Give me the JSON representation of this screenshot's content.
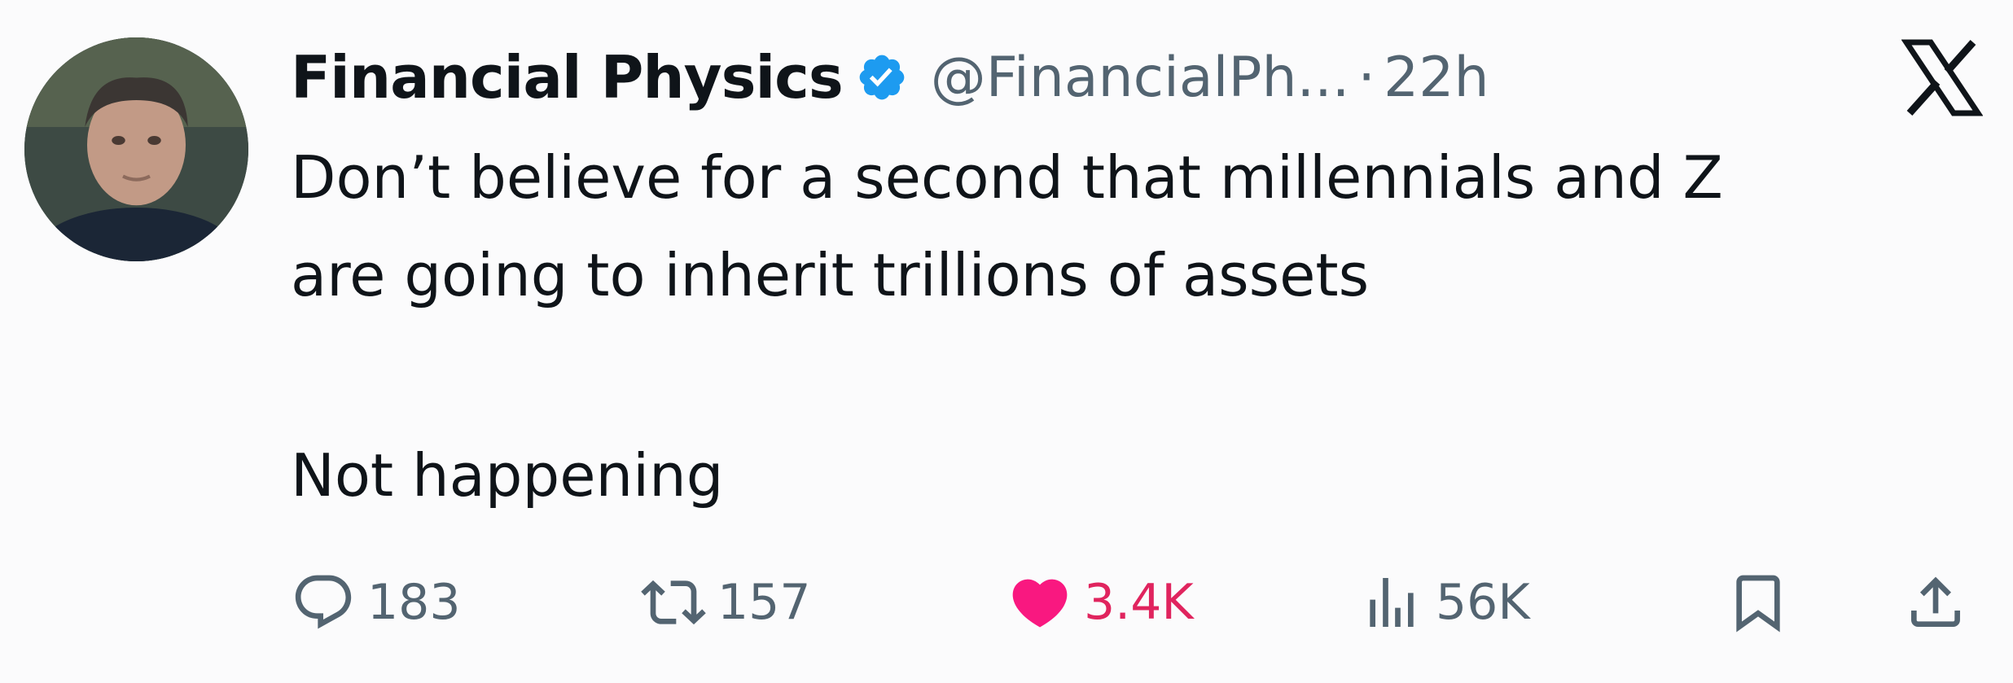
{
  "tweet": {
    "author": {
      "display_name": "Financial Physics",
      "handle": "@FinancialPh...",
      "verified": true,
      "verified_icon": "verified-badge-icon"
    },
    "separator": "·",
    "time": "22h",
    "platform_icon": "x-logo-icon",
    "text_lines": [
      "Don’t believe for a second that millennials and Z",
      "are going to inherit trillions of assets",
      "Not happening"
    ],
    "actions": {
      "reply": {
        "icon": "reply-icon",
        "count": "183"
      },
      "repost": {
        "icon": "repost-icon",
        "count": "157"
      },
      "like": {
        "icon": "heart-icon",
        "count": "3.4K",
        "color": "#f91880"
      },
      "views": {
        "icon": "views-icon",
        "count": "56K"
      },
      "bookmark": {
        "icon": "bookmark-icon"
      },
      "share": {
        "icon": "share-icon"
      }
    },
    "colors": {
      "text": "#0f1419",
      "secondary": "#536471",
      "verified": "#1d9bf0",
      "like": "#f91880",
      "background": "#fbfbfc"
    }
  }
}
